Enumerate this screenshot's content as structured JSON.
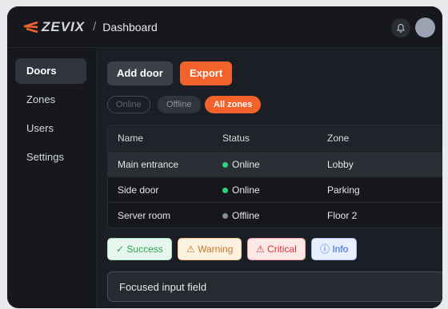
{
  "header": {
    "brand": "ZEVIX",
    "separator": "/",
    "title": "Dashboard",
    "bell_icon": "bell-icon",
    "avatar": "avatar"
  },
  "sidebar": {
    "items": [
      {
        "label": "Doors",
        "active": true
      },
      {
        "label": "Zones",
        "active": false
      },
      {
        "label": "Users",
        "active": false
      },
      {
        "label": "Settings",
        "active": false
      }
    ]
  },
  "toolbar": {
    "add_label": "Add door",
    "export_label": "Export"
  },
  "filters": {
    "online": "Online",
    "offline": "Offline",
    "all": "All zones",
    "selected": "All zones"
  },
  "table": {
    "columns": [
      "Name",
      "Status",
      "Zone"
    ],
    "rows": [
      {
        "name": "Main entrance",
        "status": "Online",
        "zone": "Lobby",
        "selected": true
      },
      {
        "name": "Side door",
        "status": "Online",
        "zone": "Parking",
        "selected": false
      },
      {
        "name": "Server room",
        "status": "Offline",
        "zone": "Floor 2",
        "selected": false
      }
    ]
  },
  "alerts": {
    "success": "✓ Success",
    "warning": "⚠ Warning",
    "critical": "⚠ Critical",
    "info": "ⓘ Info"
  },
  "input": {
    "value": "Focused input field"
  },
  "colors": {
    "accent": "#f2622a",
    "online": "#2fd37a",
    "offline": "#8a8f97"
  }
}
